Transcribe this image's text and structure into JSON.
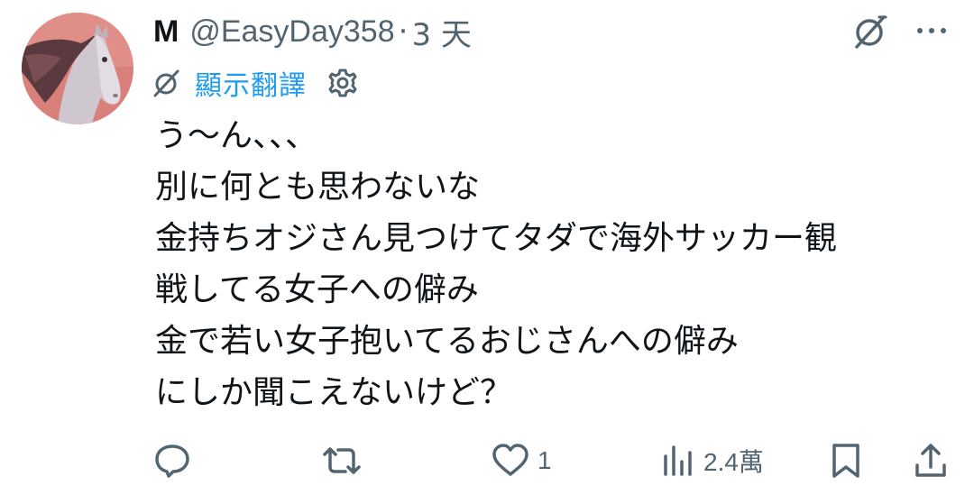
{
  "post": {
    "display_name": "M",
    "handle": "@EasyDay358",
    "separator": "·",
    "timestamp": "3 天",
    "translate_label": "顯示翻譯",
    "content_lines": [
      "う〜ん、、、",
      "別に何とも思わないな",
      "金持ちオジさん見つけてタダで海外サッカー観",
      "戦してる女子への僻み",
      "金で若い女子抱いてるおじさんへの僻み",
      "にしか聞こえないけど？"
    ]
  },
  "actions": {
    "reply": {
      "icon": "reply-icon",
      "count": ""
    },
    "repost": {
      "icon": "repost-icon",
      "count": ""
    },
    "like": {
      "icon": "heart-icon",
      "count": "1"
    },
    "views": {
      "icon": "views-icon",
      "count": "2.4萬"
    },
    "bookmark": {
      "icon": "bookmark-icon"
    },
    "share": {
      "icon": "share-icon"
    }
  },
  "colors": {
    "text": "#0f1419",
    "secondary": "#536471",
    "link": "#1d9bf0",
    "avatar_bg": "#d9807a"
  }
}
